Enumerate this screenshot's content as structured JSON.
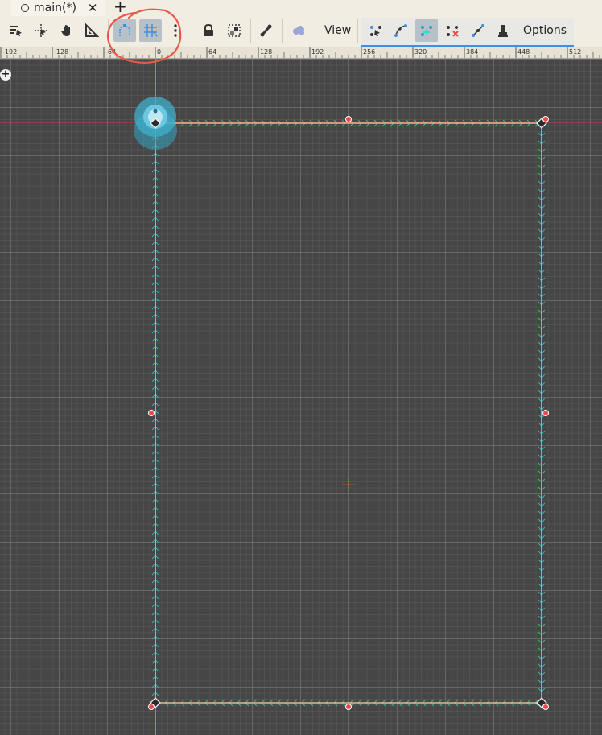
{
  "tab": {
    "title": "main(*)",
    "close_glyph": "✕",
    "new_glyph": "+"
  },
  "toolbar": {
    "view_label": "View",
    "options_label": "Options",
    "icons": [
      "select-mode-icon",
      "move-mode-icon",
      "pan-mode-icon",
      "ruler-mode-icon",
      "smart-snap-icon",
      "grid-snap-icon",
      "more-options-icon",
      "lock-icon",
      "group-icon",
      "skeleton-icon",
      "cloud-icon",
      "create-points-icon",
      "edit-points-icon",
      "connect-points-icon",
      "delete-points-icon",
      "insert-point-icon",
      "brush-icon"
    ],
    "active": [
      "smart-snap-icon",
      "grid-snap-icon",
      "connect-points-icon"
    ]
  },
  "ruler": {
    "labels": [
      "-192",
      "-128",
      "-64",
      "0",
      "64",
      "128",
      "192",
      "256",
      "320",
      "384",
      "448",
      "512"
    ]
  },
  "colors": {
    "accent": "#3d8ee6",
    "polygon": "#e8b48c",
    "normals": "#3bb39a",
    "handle": "#e84b4b",
    "annotation": "#e8584a"
  }
}
